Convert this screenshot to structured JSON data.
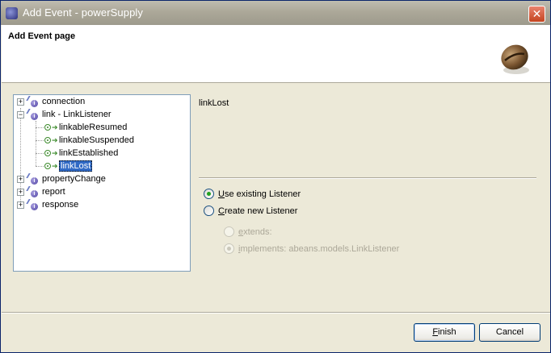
{
  "window": {
    "title": "Add Event - powerSupply",
    "close_icon": "close-icon"
  },
  "header": {
    "title": "Add Event page",
    "image_icon": "coffee-bean-icon"
  },
  "tree": {
    "items": [
      {
        "label": "connection",
        "expanded": false,
        "icon": "event-icon"
      },
      {
        "label": "link - LinkListener",
        "expanded": true,
        "icon": "event-icon",
        "children": [
          {
            "label": "linkableResumed",
            "icon": "method-icon"
          },
          {
            "label": "linkableSuspended",
            "icon": "method-icon"
          },
          {
            "label": "linkEstablished",
            "icon": "method-icon"
          },
          {
            "label": "linkLost",
            "icon": "method-icon",
            "selected": true
          }
        ]
      },
      {
        "label": "propertyChange",
        "expanded": false,
        "icon": "event-icon"
      },
      {
        "label": "report",
        "expanded": false,
        "icon": "event-icon"
      },
      {
        "label": "response",
        "expanded": false,
        "icon": "event-icon"
      }
    ]
  },
  "detail": {
    "selected_name": "linkLost",
    "options": {
      "use_existing": {
        "label_u": "U",
        "label_rest": "se existing Listener",
        "checked": true
      },
      "create_new": {
        "label_u": "C",
        "label_rest": "reate new Listener",
        "checked": false
      },
      "extends": {
        "label_u": "e",
        "label_rest": "xtends:",
        "checked": false,
        "enabled": false
      },
      "implements": {
        "label_u": "i",
        "label_rest": "mplements: abeans.models.LinkListener",
        "checked": true,
        "enabled": false
      }
    }
  },
  "buttons": {
    "finish_u": "F",
    "finish_rest": "inish",
    "cancel": "Cancel"
  }
}
